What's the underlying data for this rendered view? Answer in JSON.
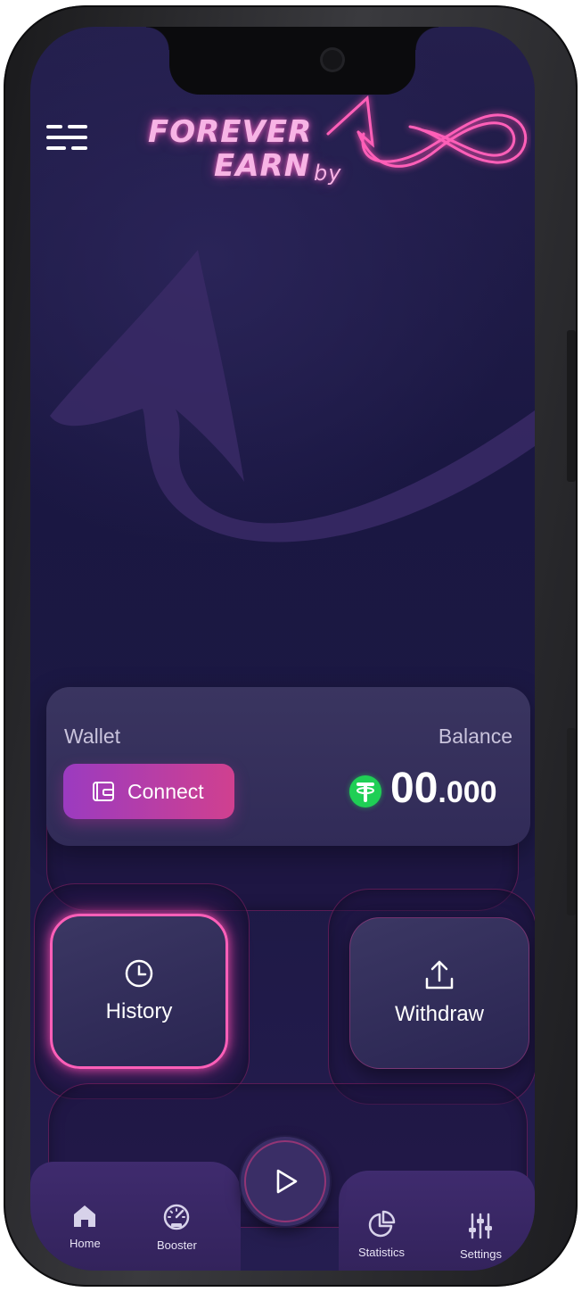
{
  "app": {
    "logo_line1": "FOREVER",
    "logo_line2": "EARN",
    "logo_by": "by"
  },
  "wallet": {
    "wallet_label": "Wallet",
    "balance_label": "Balance",
    "connect_label": "Connect",
    "balance_whole": "00",
    "balance_decimal": ".000",
    "currency_icon": "tether-usdt-icon"
  },
  "actions": {
    "history_label": "History",
    "withdraw_label": "Withdraw"
  },
  "nav": {
    "items": [
      {
        "label": "Home",
        "icon": "home-icon"
      },
      {
        "label": "Booster",
        "icon": "speedometer-icon"
      },
      {
        "label": "Statistics",
        "icon": "pie-chart-icon"
      },
      {
        "label": "Settings",
        "icon": "sliders-icon"
      }
    ],
    "center_icon": "play-icon"
  },
  "colors": {
    "accent_pink": "#ff5fb8",
    "connect_gradient_start": "#9b3bc0",
    "connect_gradient_end": "#d0408f",
    "usdt_green": "#1fcf55",
    "background": "#1a1742"
  }
}
